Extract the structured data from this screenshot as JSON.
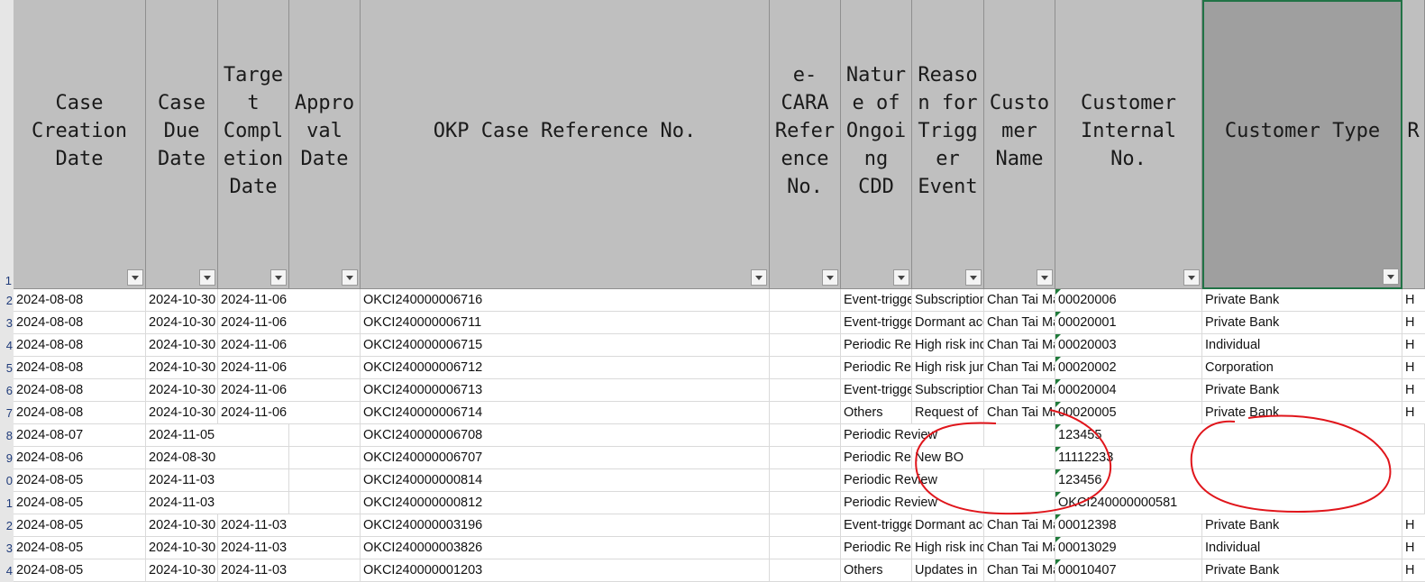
{
  "headers": [
    "Case\nCreation\nDate",
    "Case\nDue\nDate",
    "Targe\nt\nCompl\netion\nDate",
    "Appro\nval\nDate",
    "OKP Case Reference No.",
    "e-\nCARA\nRefer\nence\nNo.",
    "Natur\ne of\nOngoi\nng\nCDD",
    "Reaso\nn for\nTrigg\ner\nEvent",
    "Custo\nmer\nName",
    "Customer\nInternal\nNo.",
    "Customer Type",
    "R"
  ],
  "row_numbers": [
    "1",
    "2",
    "3",
    "4",
    "5",
    "6",
    "7",
    "8",
    "9",
    "0",
    "1",
    "2",
    "3",
    "4"
  ],
  "rows": [
    [
      "2024-08-08",
      "2024-10-30",
      "2024-11-06",
      "",
      "OKCI240000006716",
      "",
      "Event-triggered",
      "Subscription",
      "Chan Tai Man",
      "00020006",
      "Private Bank",
      "H"
    ],
    [
      "2024-08-08",
      "2024-10-30",
      "2024-11-06",
      "",
      "OKCI240000006711",
      "",
      "Event-triggered",
      "Dormant account",
      "Chan Tai Man",
      "00020001",
      "Private Bank",
      "H"
    ],
    [
      "2024-08-08",
      "2024-10-30",
      "2024-11-06",
      "",
      "OKCI240000006715",
      "",
      "Periodic Review",
      "High risk indicator",
      "Chan Tai Man",
      "00020003",
      "Individual",
      "H"
    ],
    [
      "2024-08-08",
      "2024-10-30",
      "2024-11-06",
      "",
      "OKCI240000006712",
      "",
      "Periodic Review",
      "High risk jurisdiction",
      "Chan Tai Man",
      "00020002",
      "Corporation",
      "H"
    ],
    [
      "2024-08-08",
      "2024-10-30",
      "2024-11-06",
      "",
      "OKCI240000006713",
      "",
      "Event-triggered",
      "Subscription",
      "Chan Tai Man",
      "00020004",
      "Private Bank",
      "H"
    ],
    [
      "2024-08-08",
      "2024-10-30",
      "2024-11-06",
      "",
      "OKCI240000006714",
      "",
      "Others",
      "Request of",
      "Chan Tai Man",
      "00020005",
      "Private Bank",
      "H"
    ],
    [
      "2024-08-07",
      "2024-11-05",
      "",
      "",
      "OKCI240000006708",
      "",
      "Periodic Review",
      "",
      "",
      "123455",
      "",
      ""
    ],
    [
      "2024-08-06",
      "2024-08-30",
      "",
      "",
      "OKCI240000006707",
      "",
      "Periodic Review",
      "New BO",
      "",
      "11112233",
      "",
      ""
    ],
    [
      "2024-08-05",
      "2024-11-03",
      "",
      "",
      "OKCI240000000814",
      "",
      "Periodic Review",
      "",
      "",
      "123456",
      "",
      ""
    ],
    [
      "2024-08-05",
      "2024-11-03",
      "",
      "",
      "OKCI240000000812",
      "",
      "Periodic Review",
      "",
      "",
      "OKCI240000000581",
      "",
      ""
    ],
    [
      "2024-08-05",
      "2024-10-30",
      "2024-11-03",
      "",
      "OKCI240000003196",
      "",
      "Event-triggered",
      "Dormant account",
      "Chan Tai Man",
      "00012398",
      "Private Bank",
      "H"
    ],
    [
      "2024-08-05",
      "2024-10-30",
      "2024-11-03",
      "",
      "OKCI240000003826",
      "",
      "Periodic Review",
      "High risk indicator",
      "Chan Tai Man",
      "00013029",
      "Individual",
      "H"
    ],
    [
      "2024-08-05",
      "2024-10-30",
      "2024-11-03",
      "",
      "OKCI240000001203",
      "",
      "Others",
      "Updates in",
      "Chan Tai Man",
      "00010407",
      "Private Bank",
      "H"
    ]
  ],
  "colors": {
    "header_bg": "#bfbfbf",
    "selected_header_bg": "#9f9f9f",
    "selection_border": "#217346",
    "annotation_ink": "#e0151b"
  }
}
